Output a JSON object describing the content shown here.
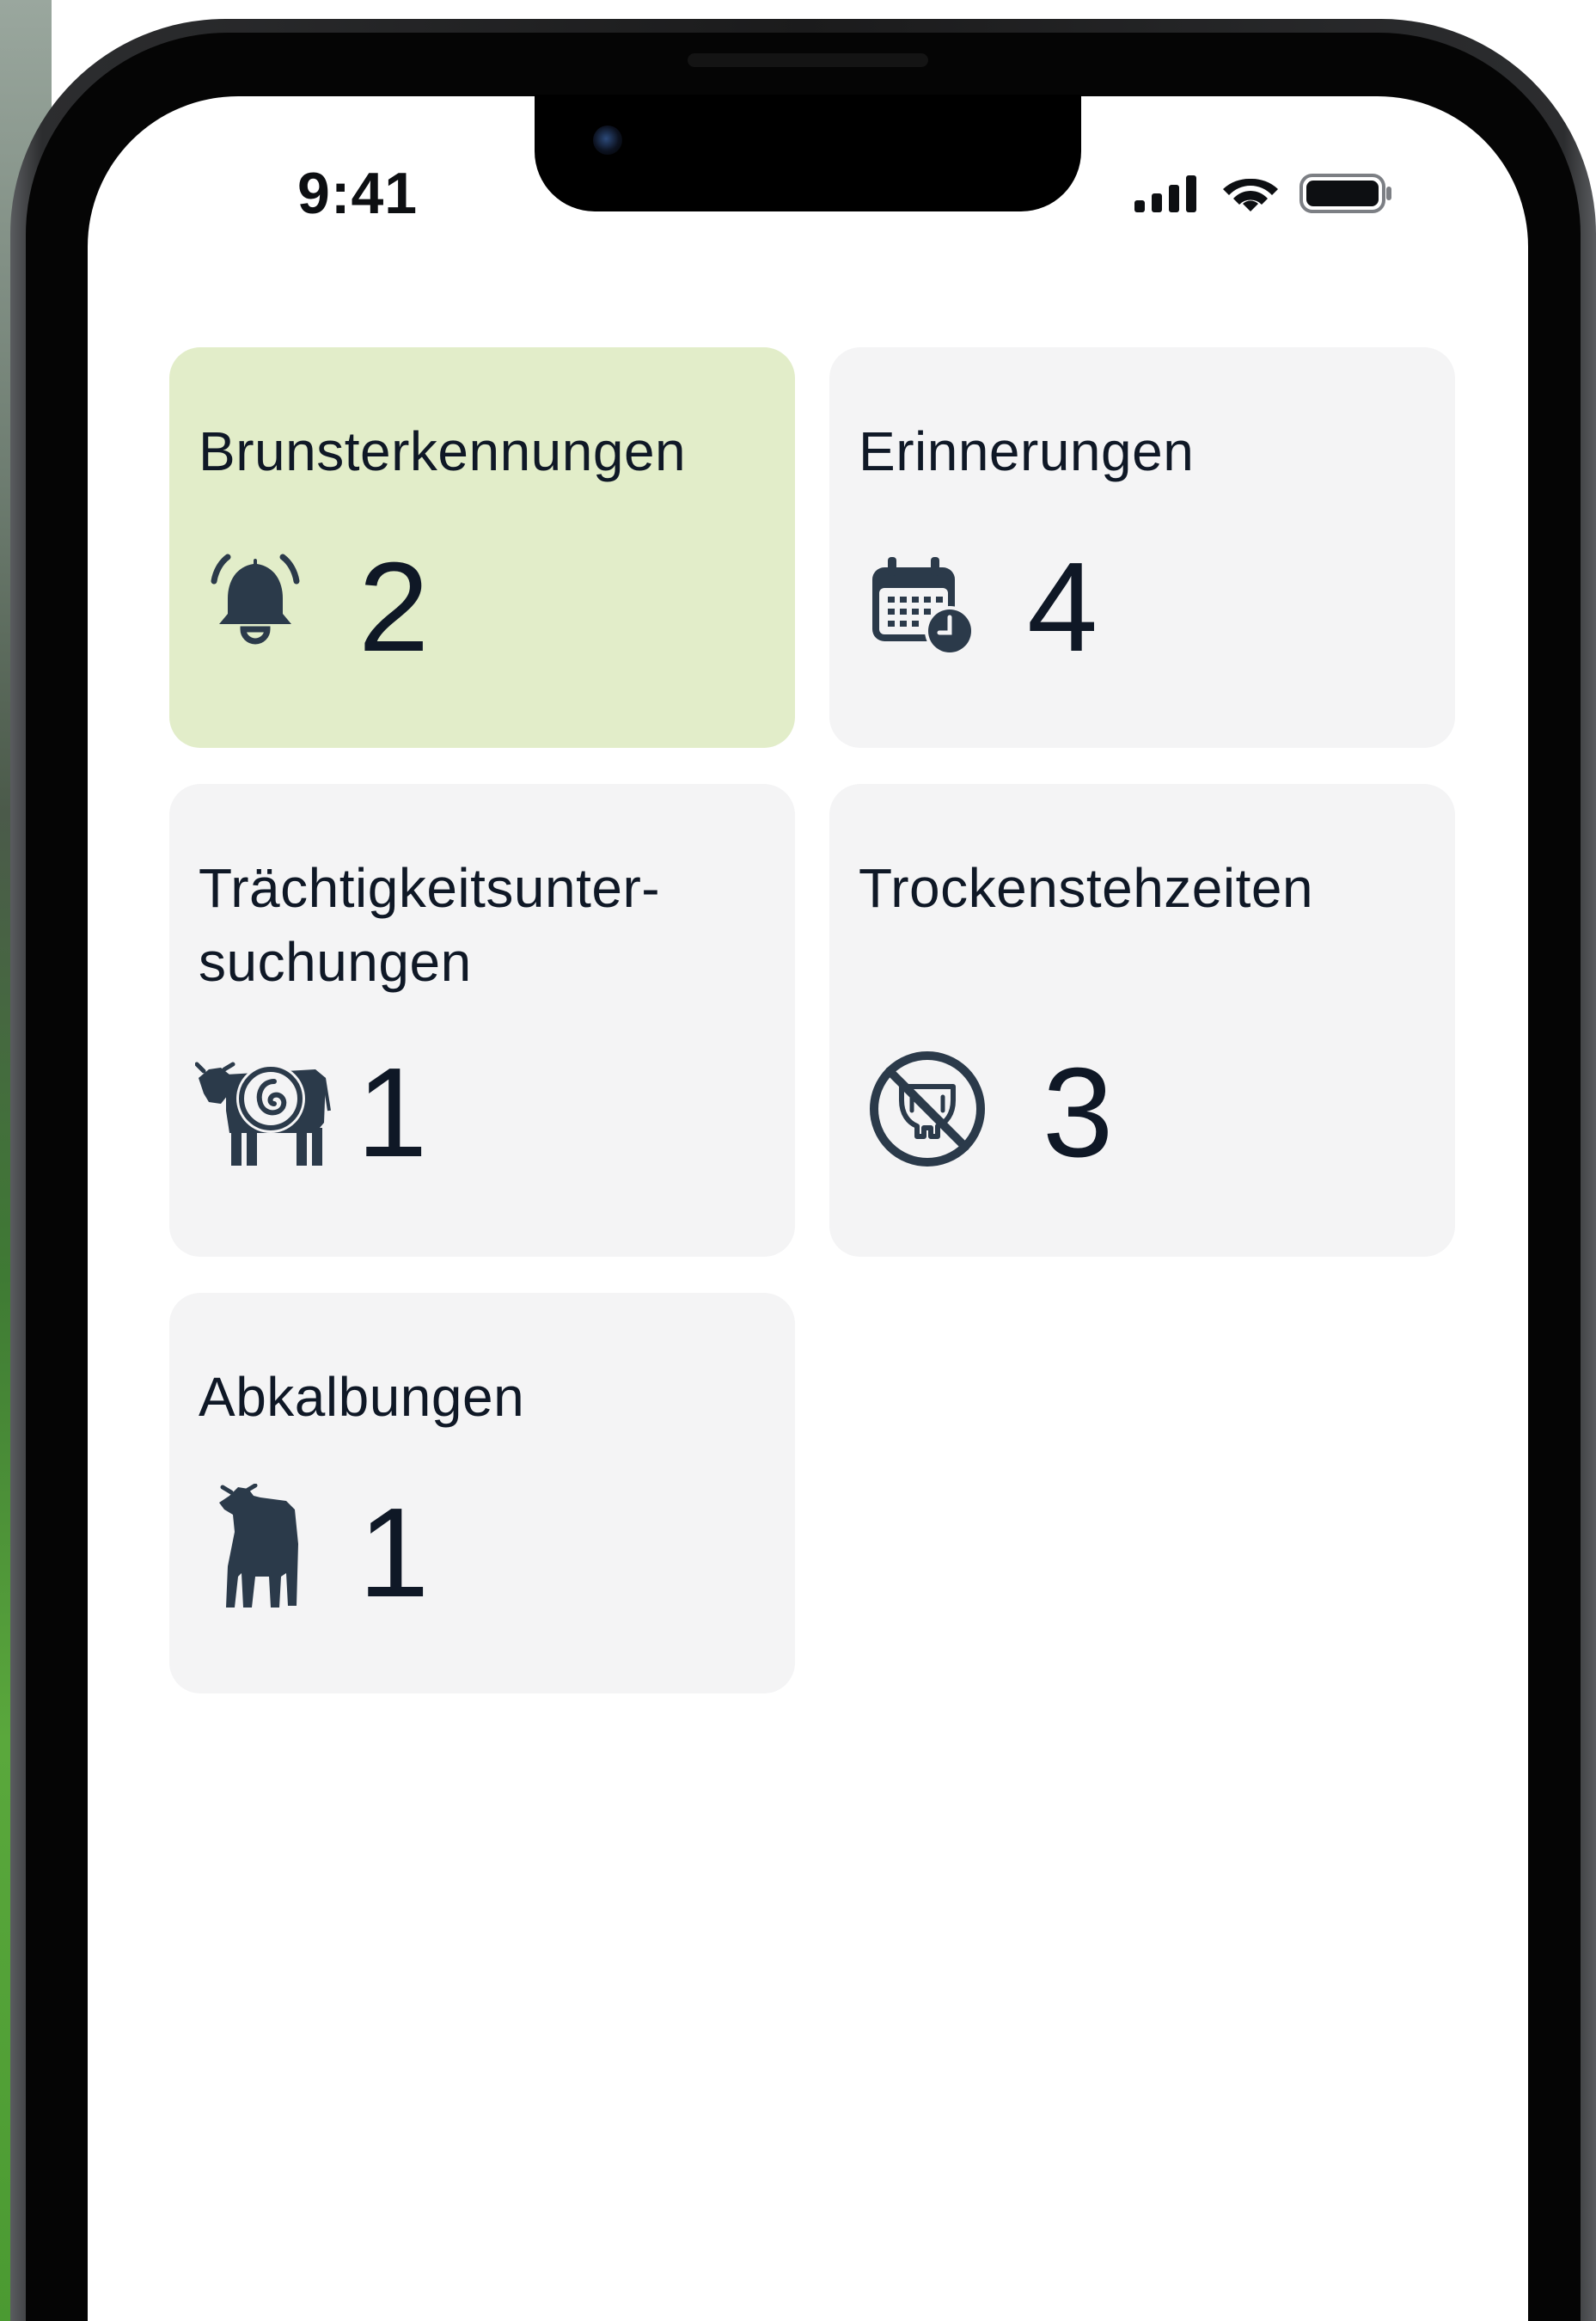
{
  "status_bar": {
    "time": "9:41",
    "icons": [
      "cellular-signal-icon",
      "wifi-icon",
      "battery-icon"
    ]
  },
  "cards": [
    {
      "title": "Brunsterkennungen",
      "count": "2",
      "icon": "bell-ringing-icon",
      "highlighted": true,
      "background": "#e2edc9"
    },
    {
      "title": "Erinnerungen",
      "count": "4",
      "icon": "calendar-clock-icon",
      "highlighted": false,
      "background": "#f4f4f5"
    },
    {
      "title": "Trächtigkeitsunter-\nsuchungen",
      "count": "1",
      "icon": "cow-pregnancy-icon",
      "highlighted": false,
      "background": "#f4f4f5"
    },
    {
      "title": "Trockenstehzeiten",
      "count": "3",
      "icon": "no-milking-udder-icon",
      "highlighted": false,
      "background": "#f4f4f5"
    },
    {
      "title": "Abkalbungen",
      "count": "1",
      "icon": "calf-icon",
      "highlighted": false,
      "background": "#f4f4f5"
    }
  ],
  "colors": {
    "text": "#0f1826",
    "icon": "#2b3a4a",
    "card_default": "#f4f4f5",
    "card_highlight": "#e2edc9"
  }
}
